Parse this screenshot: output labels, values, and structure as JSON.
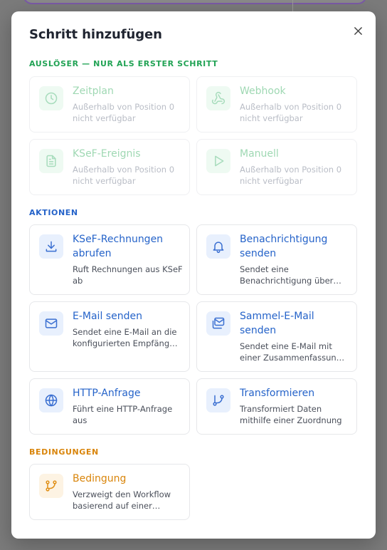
{
  "modal": {
    "title": "Schritt hinzufügen",
    "close_icon": "close-icon"
  },
  "sections": {
    "triggers": {
      "label": "AUSLÖSER — NUR ALS ERSTER SCHRITT",
      "color": "#22a355"
    },
    "actions": {
      "label": "AKTIONEN",
      "color": "#2563c9"
    },
    "conditions": {
      "label": "BEDINGUNGEN",
      "color": "#d9850b"
    }
  },
  "triggers": [
    {
      "title": "Zeitplan",
      "desc": "Außerhalb von Position 0 nicht verfügbar",
      "icon": "clock-icon"
    },
    {
      "title": "Webhook",
      "desc": "Außerhalb von Position 0 nicht verfügbar",
      "icon": "webhook-icon"
    },
    {
      "title": "KSeF-Ereignis",
      "desc": "Außerhalb von Position 0 nicht verfügbar",
      "icon": "file-text-icon"
    },
    {
      "title": "Manuell",
      "desc": "Außerhalb von Position 0 nicht verfügbar",
      "icon": "play-icon"
    }
  ],
  "actions": [
    {
      "title": "KSeF-Rechnungen abrufen",
      "desc": "Ruft Rechnungen aus KSeF ab",
      "icon": "download-icon"
    },
    {
      "title": "Benachrichtigung senden",
      "desc": "Sendet eine Benachrichtigung über…",
      "icon": "bell-icon"
    },
    {
      "title": "E-Mail senden",
      "desc": "Sendet eine E-Mail an die konfigurierten Empfäng…",
      "icon": "mail-icon"
    },
    {
      "title": "Sammel-E-Mail senden",
      "desc": "Sendet eine E-Mail mit einer Zusammenfassun…",
      "icon": "mail-stack-icon"
    },
    {
      "title": "HTTP-Anfrage",
      "desc": "Führt eine HTTP-Anfrage aus",
      "icon": "globe-icon"
    },
    {
      "title": "Transformieren",
      "desc": "Transformiert Daten mithilfe einer Zuordnung",
      "icon": "git-branch-icon"
    }
  ],
  "conditions": [
    {
      "title": "Bedingung",
      "desc": "Verzweigt den Workflow basierend auf einer…",
      "icon": "branch-icon"
    }
  ]
}
